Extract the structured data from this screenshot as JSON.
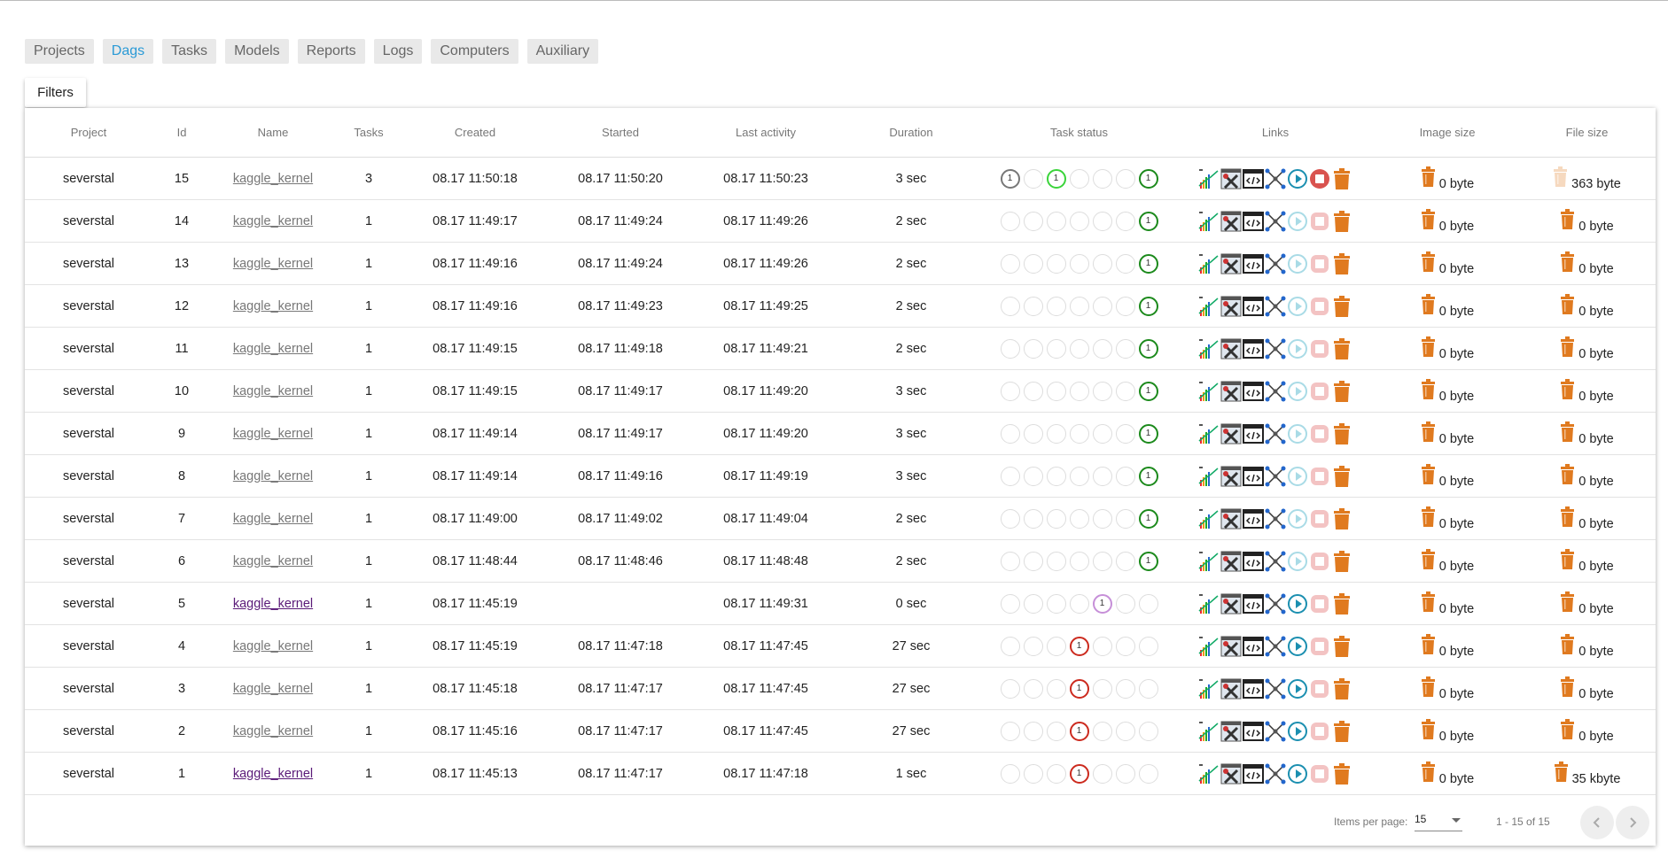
{
  "nav": [
    "Projects",
    "Dags",
    "Tasks",
    "Models",
    "Reports",
    "Logs",
    "Computers",
    "Auxiliary"
  ],
  "nav_active": "Dags",
  "filters_label": "Filters",
  "columns": [
    "Project",
    "Id",
    "Name",
    "Tasks",
    "Created",
    "Started",
    "Last activity",
    "Duration",
    "Task status",
    "Links",
    "Image size",
    "File size"
  ],
  "rows": [
    {
      "project": "severstal",
      "id": "15",
      "name": "kaggle_kernel",
      "tasks": "3",
      "created": "08.17 11:50:18",
      "started": "08.17 11:50:20",
      "last": "08.17 11:50:23",
      "duration": "3 sec",
      "status": [
        {
          "c": "gray",
          "n": "1"
        },
        {
          "c": "",
          "n": ""
        },
        {
          "c": "lgreen",
          "n": "1"
        },
        {
          "c": "",
          "n": ""
        },
        {
          "c": "",
          "n": ""
        },
        {
          "c": "",
          "n": ""
        },
        {
          "c": "green",
          "n": "1"
        }
      ],
      "image": "0 byte",
      "file": "363 byte",
      "active": true,
      "stop": true,
      "fileFaded": true,
      "visited": false
    },
    {
      "project": "severstal",
      "id": "14",
      "name": "kaggle_kernel",
      "tasks": "1",
      "created": "08.17 11:49:17",
      "started": "08.17 11:49:24",
      "last": "08.17 11:49:26",
      "duration": "2 sec",
      "status": [
        {
          "c": "",
          "n": ""
        },
        {
          "c": "",
          "n": ""
        },
        {
          "c": "",
          "n": ""
        },
        {
          "c": "",
          "n": ""
        },
        {
          "c": "",
          "n": ""
        },
        {
          "c": "",
          "n": ""
        },
        {
          "c": "green",
          "n": "1"
        }
      ],
      "image": "0 byte",
      "file": "0 byte",
      "active": false,
      "stop": false,
      "fileFaded": false,
      "visited": false
    },
    {
      "project": "severstal",
      "id": "13",
      "name": "kaggle_kernel",
      "tasks": "1",
      "created": "08.17 11:49:16",
      "started": "08.17 11:49:24",
      "last": "08.17 11:49:26",
      "duration": "2 sec",
      "status": [
        {
          "c": "",
          "n": ""
        },
        {
          "c": "",
          "n": ""
        },
        {
          "c": "",
          "n": ""
        },
        {
          "c": "",
          "n": ""
        },
        {
          "c": "",
          "n": ""
        },
        {
          "c": "",
          "n": ""
        },
        {
          "c": "green",
          "n": "1"
        }
      ],
      "image": "0 byte",
      "file": "0 byte",
      "active": false,
      "stop": false,
      "fileFaded": false,
      "visited": false
    },
    {
      "project": "severstal",
      "id": "12",
      "name": "kaggle_kernel",
      "tasks": "1",
      "created": "08.17 11:49:16",
      "started": "08.17 11:49:23",
      "last": "08.17 11:49:25",
      "duration": "2 sec",
      "status": [
        {
          "c": "",
          "n": ""
        },
        {
          "c": "",
          "n": ""
        },
        {
          "c": "",
          "n": ""
        },
        {
          "c": "",
          "n": ""
        },
        {
          "c": "",
          "n": ""
        },
        {
          "c": "",
          "n": ""
        },
        {
          "c": "green",
          "n": "1"
        }
      ],
      "image": "0 byte",
      "file": "0 byte",
      "active": false,
      "stop": false,
      "fileFaded": false,
      "visited": false
    },
    {
      "project": "severstal",
      "id": "11",
      "name": "kaggle_kernel",
      "tasks": "1",
      "created": "08.17 11:49:15",
      "started": "08.17 11:49:18",
      "last": "08.17 11:49:21",
      "duration": "2 sec",
      "status": [
        {
          "c": "",
          "n": ""
        },
        {
          "c": "",
          "n": ""
        },
        {
          "c": "",
          "n": ""
        },
        {
          "c": "",
          "n": ""
        },
        {
          "c": "",
          "n": ""
        },
        {
          "c": "",
          "n": ""
        },
        {
          "c": "green",
          "n": "1"
        }
      ],
      "image": "0 byte",
      "file": "0 byte",
      "active": false,
      "stop": false,
      "fileFaded": false,
      "visited": false
    },
    {
      "project": "severstal",
      "id": "10",
      "name": "kaggle_kernel",
      "tasks": "1",
      "created": "08.17 11:49:15",
      "started": "08.17 11:49:17",
      "last": "08.17 11:49:20",
      "duration": "3 sec",
      "status": [
        {
          "c": "",
          "n": ""
        },
        {
          "c": "",
          "n": ""
        },
        {
          "c": "",
          "n": ""
        },
        {
          "c": "",
          "n": ""
        },
        {
          "c": "",
          "n": ""
        },
        {
          "c": "",
          "n": ""
        },
        {
          "c": "green",
          "n": "1"
        }
      ],
      "image": "0 byte",
      "file": "0 byte",
      "active": false,
      "stop": false,
      "fileFaded": false,
      "visited": false
    },
    {
      "project": "severstal",
      "id": "9",
      "name": "kaggle_kernel",
      "tasks": "1",
      "created": "08.17 11:49:14",
      "started": "08.17 11:49:17",
      "last": "08.17 11:49:20",
      "duration": "3 sec",
      "status": [
        {
          "c": "",
          "n": ""
        },
        {
          "c": "",
          "n": ""
        },
        {
          "c": "",
          "n": ""
        },
        {
          "c": "",
          "n": ""
        },
        {
          "c": "",
          "n": ""
        },
        {
          "c": "",
          "n": ""
        },
        {
          "c": "green",
          "n": "1"
        }
      ],
      "image": "0 byte",
      "file": "0 byte",
      "active": false,
      "stop": false,
      "fileFaded": false,
      "visited": false
    },
    {
      "project": "severstal",
      "id": "8",
      "name": "kaggle_kernel",
      "tasks": "1",
      "created": "08.17 11:49:14",
      "started": "08.17 11:49:16",
      "last": "08.17 11:49:19",
      "duration": "3 sec",
      "status": [
        {
          "c": "",
          "n": ""
        },
        {
          "c": "",
          "n": ""
        },
        {
          "c": "",
          "n": ""
        },
        {
          "c": "",
          "n": ""
        },
        {
          "c": "",
          "n": ""
        },
        {
          "c": "",
          "n": ""
        },
        {
          "c": "green",
          "n": "1"
        }
      ],
      "image": "0 byte",
      "file": "0 byte",
      "active": false,
      "stop": false,
      "fileFaded": false,
      "visited": false
    },
    {
      "project": "severstal",
      "id": "7",
      "name": "kaggle_kernel",
      "tasks": "1",
      "created": "08.17 11:49:00",
      "started": "08.17 11:49:02",
      "last": "08.17 11:49:04",
      "duration": "2 sec",
      "status": [
        {
          "c": "",
          "n": ""
        },
        {
          "c": "",
          "n": ""
        },
        {
          "c": "",
          "n": ""
        },
        {
          "c": "",
          "n": ""
        },
        {
          "c": "",
          "n": ""
        },
        {
          "c": "",
          "n": ""
        },
        {
          "c": "green",
          "n": "1"
        }
      ],
      "image": "0 byte",
      "file": "0 byte",
      "active": false,
      "stop": false,
      "fileFaded": false,
      "visited": false
    },
    {
      "project": "severstal",
      "id": "6",
      "name": "kaggle_kernel",
      "tasks": "1",
      "created": "08.17 11:48:44",
      "started": "08.17 11:48:46",
      "last": "08.17 11:48:48",
      "duration": "2 sec",
      "status": [
        {
          "c": "",
          "n": ""
        },
        {
          "c": "",
          "n": ""
        },
        {
          "c": "",
          "n": ""
        },
        {
          "c": "",
          "n": ""
        },
        {
          "c": "",
          "n": ""
        },
        {
          "c": "",
          "n": ""
        },
        {
          "c": "green",
          "n": "1"
        }
      ],
      "image": "0 byte",
      "file": "0 byte",
      "active": false,
      "stop": false,
      "fileFaded": false,
      "visited": false
    },
    {
      "project": "severstal",
      "id": "5",
      "name": "kaggle_kernel",
      "tasks": "1",
      "created": "08.17 11:45:19",
      "started": "",
      "last": "08.17 11:49:31",
      "duration": "0 sec",
      "status": [
        {
          "c": "",
          "n": ""
        },
        {
          "c": "",
          "n": ""
        },
        {
          "c": "",
          "n": ""
        },
        {
          "c": "",
          "n": ""
        },
        {
          "c": "purple",
          "n": "1"
        },
        {
          "c": "",
          "n": ""
        },
        {
          "c": "",
          "n": ""
        }
      ],
      "image": "0 byte",
      "file": "0 byte",
      "active": true,
      "stop": false,
      "fileFaded": false,
      "visited": true
    },
    {
      "project": "severstal",
      "id": "4",
      "name": "kaggle_kernel",
      "tasks": "1",
      "created": "08.17 11:45:19",
      "started": "08.17 11:47:18",
      "last": "08.17 11:47:45",
      "duration": "27 sec",
      "status": [
        {
          "c": "",
          "n": ""
        },
        {
          "c": "",
          "n": ""
        },
        {
          "c": "",
          "n": ""
        },
        {
          "c": "red",
          "n": "1"
        },
        {
          "c": "",
          "n": ""
        },
        {
          "c": "",
          "n": ""
        },
        {
          "c": "",
          "n": ""
        }
      ],
      "image": "0 byte",
      "file": "0 byte",
      "active": true,
      "stop": false,
      "fileFaded": false,
      "visited": false
    },
    {
      "project": "severstal",
      "id": "3",
      "name": "kaggle_kernel",
      "tasks": "1",
      "created": "08.17 11:45:18",
      "started": "08.17 11:47:17",
      "last": "08.17 11:47:45",
      "duration": "27 sec",
      "status": [
        {
          "c": "",
          "n": ""
        },
        {
          "c": "",
          "n": ""
        },
        {
          "c": "",
          "n": ""
        },
        {
          "c": "red",
          "n": "1"
        },
        {
          "c": "",
          "n": ""
        },
        {
          "c": "",
          "n": ""
        },
        {
          "c": "",
          "n": ""
        }
      ],
      "image": "0 byte",
      "file": "0 byte",
      "active": true,
      "stop": false,
      "fileFaded": false,
      "visited": false
    },
    {
      "project": "severstal",
      "id": "2",
      "name": "kaggle_kernel",
      "tasks": "1",
      "created": "08.17 11:45:16",
      "started": "08.17 11:47:17",
      "last": "08.17 11:47:45",
      "duration": "27 sec",
      "status": [
        {
          "c": "",
          "n": ""
        },
        {
          "c": "",
          "n": ""
        },
        {
          "c": "",
          "n": ""
        },
        {
          "c": "red",
          "n": "1"
        },
        {
          "c": "",
          "n": ""
        },
        {
          "c": "",
          "n": ""
        },
        {
          "c": "",
          "n": ""
        }
      ],
      "image": "0 byte",
      "file": "0 byte",
      "active": true,
      "stop": false,
      "fileFaded": false,
      "visited": false
    },
    {
      "project": "severstal",
      "id": "1",
      "name": "kaggle_kernel",
      "tasks": "1",
      "created": "08.17 11:45:13",
      "started": "08.17 11:47:17",
      "last": "08.17 11:47:18",
      "duration": "1 sec",
      "status": [
        {
          "c": "",
          "n": ""
        },
        {
          "c": "",
          "n": ""
        },
        {
          "c": "",
          "n": ""
        },
        {
          "c": "red",
          "n": "1"
        },
        {
          "c": "",
          "n": ""
        },
        {
          "c": "",
          "n": ""
        },
        {
          "c": "",
          "n": ""
        }
      ],
      "image": "0 byte",
      "file": "35 kbyte",
      "active": true,
      "stop": false,
      "fileFaded": false,
      "visited": true
    }
  ],
  "link_icons": [
    "chart-icon",
    "config-tools-icon",
    "code-icon",
    "graph-icon",
    "play-icon",
    "stop-icon",
    "trash-icon"
  ],
  "footer": {
    "items_per_page_label": "Items per page:",
    "items_per_page": "15",
    "range": "1 - 15 of 15"
  },
  "colors": {
    "accent": "#2a9ad6",
    "trash": "#e07a1f",
    "success": "#1c8a1c",
    "failed": "#cc2a1e",
    "queued": "#c68fd8",
    "in_progress": "#3ad43a",
    "stop": "#d9534f"
  }
}
